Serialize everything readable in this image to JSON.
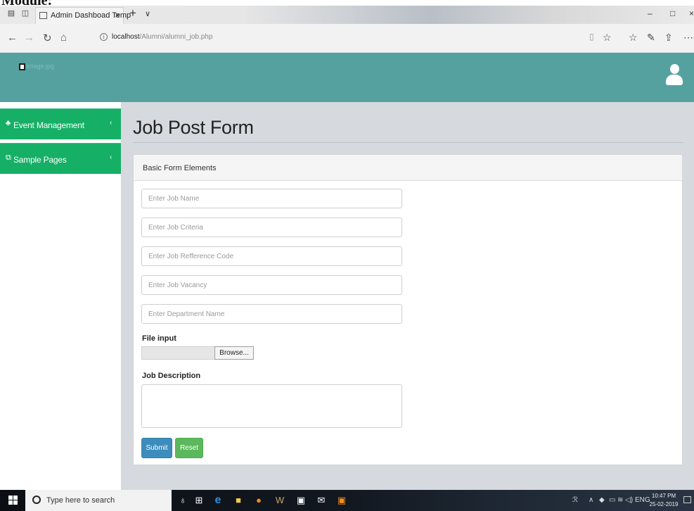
{
  "document": {
    "heading": "Module:"
  },
  "browser": {
    "tab_title": "Admin Dashboad Temp",
    "tab_close": "×",
    "new_tab": "+",
    "tab_menu": "∨",
    "url_host": "localhost",
    "url_path": "/Alumni/alumni_job.php",
    "window": {
      "minimize": "–",
      "maximize": "□",
      "close": "×"
    },
    "icons": [
      "back-icon",
      "forward-icon",
      "refresh-icon",
      "home-icon",
      "reading-view-icon",
      "favorite-star-icon",
      "favorites-list-icon",
      "pen-icon",
      "share-icon",
      "more-icon"
    ]
  },
  "header": {
    "logo_alt": "image.jpg",
    "bg_color": "#55a1a0",
    "user_icon": "user-icon"
  },
  "sidebar": {
    "items": [
      {
        "label": "Event Management",
        "icon": "sitemap-icon"
      },
      {
        "label": "Sample Pages",
        "icon": "copy-icon"
      }
    ],
    "accent": "#16af66"
  },
  "main": {
    "title": "Job Post Form",
    "panel_title": "Basic Form Elements",
    "fields": [
      {
        "placeholder": "Enter Job Name",
        "value": ""
      },
      {
        "placeholder": "Enter Job Criteria",
        "value": ""
      },
      {
        "placeholder": "Enter Job Refference Code",
        "value": ""
      },
      {
        "placeholder": "Enter Job Vacancy",
        "value": ""
      },
      {
        "placeholder": "Enter Department Name",
        "value": ""
      }
    ],
    "file_label": "File input",
    "browse_label": "Browse...",
    "description_label": "Job Description",
    "submit_label": "Submit",
    "reset_label": "Reset",
    "submit_color": "#3c8dbc",
    "reset_color": "#5cb85c"
  },
  "taskbar": {
    "search_placeholder": "Type here to search",
    "language": "ENG",
    "time": "10:47 PM",
    "date": "25-02-2019",
    "apps": [
      "mic-icon",
      "task-view-icon",
      "edge-icon",
      "file-explorer-icon",
      "firefox-icon",
      "winamp-icon",
      "store-icon",
      "mail-icon",
      "xampp-icon"
    ]
  }
}
